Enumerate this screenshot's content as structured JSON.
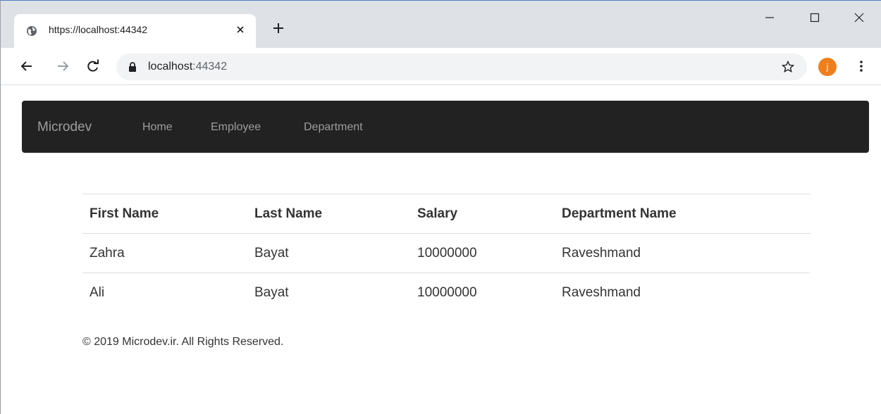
{
  "browser": {
    "tab": {
      "title": "https://localhost:44342"
    },
    "address": {
      "host": "localhost",
      "port": ":44342"
    },
    "avatar_letter": "j"
  },
  "navbar": {
    "brand": "Microdev",
    "links": [
      "Home",
      "Employee",
      "Department"
    ]
  },
  "table": {
    "headers": [
      "First Name",
      "Last Name",
      "Salary",
      "Department Name"
    ],
    "rows": [
      [
        "Zahra",
        "Bayat",
        "10000000",
        "Raveshmand"
      ],
      [
        "Ali",
        "Bayat",
        "10000000",
        "Raveshmand"
      ]
    ]
  },
  "footer": {
    "text": "© 2019 Microdev.ir. All Rights Reserved."
  },
  "colors": {
    "navbar_bg": "#222222",
    "nav_text": "#9d9d9d",
    "avatar": "#f07f1b"
  }
}
